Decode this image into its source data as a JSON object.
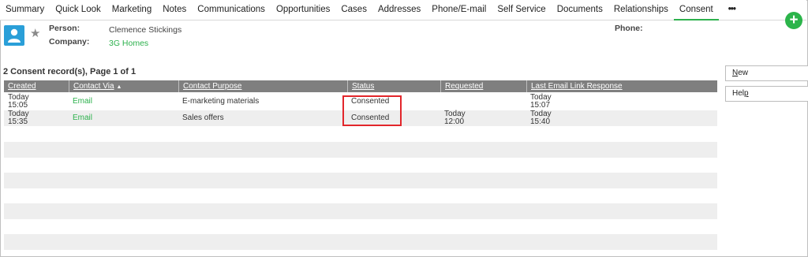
{
  "tabs": [
    {
      "label": "Summary"
    },
    {
      "label": "Quick Look"
    },
    {
      "label": "Marketing"
    },
    {
      "label": "Notes"
    },
    {
      "label": "Communications"
    },
    {
      "label": "Opportunities"
    },
    {
      "label": "Cases"
    },
    {
      "label": "Addresses"
    },
    {
      "label": "Phone/E-mail"
    },
    {
      "label": "Self Service"
    },
    {
      "label": "Documents"
    },
    {
      "label": "Relationships"
    },
    {
      "label": "Consent",
      "active": true
    },
    {
      "label": "•••"
    }
  ],
  "add_button": {
    "label": "+",
    "color": "#2bb44a"
  },
  "header": {
    "person_label": "Person:",
    "person_value": "Clemence Stickings",
    "company_label": "Company:",
    "company_value": "3G Homes",
    "phone_label": "Phone:"
  },
  "records_title": "2 Consent record(s), Page 1 of 1",
  "grid": {
    "columns": [
      "Created",
      "Contact Via",
      "Contact Purpose",
      "Status",
      "Requested",
      "Last Email Link Response"
    ],
    "sorted_column": "Contact Via",
    "rows": [
      {
        "created_1": "Today",
        "created_2": "15:05",
        "contact_via": "Email",
        "contact_purpose": "E-marketing materials",
        "status": "Consented",
        "requested_1": "",
        "requested_2": "",
        "last_1": "Today",
        "last_2": "15:07"
      },
      {
        "created_1": "Today",
        "created_2": "15:35",
        "contact_via": "Email",
        "contact_purpose": "Sales offers",
        "status": "Consented",
        "requested_1": "Today",
        "requested_2": "12:00",
        "last_1": "Today",
        "last_2": "15:40"
      }
    ]
  },
  "side_buttons": {
    "new_key": "N",
    "new_rest": "ew",
    "help_pre": "Hel",
    "help_key": "p"
  },
  "colors": {
    "accent": "#2db14d",
    "header_bg": "#7f7f7f",
    "highlight": "#e2262b",
    "avatar": "#2a9fd8"
  }
}
